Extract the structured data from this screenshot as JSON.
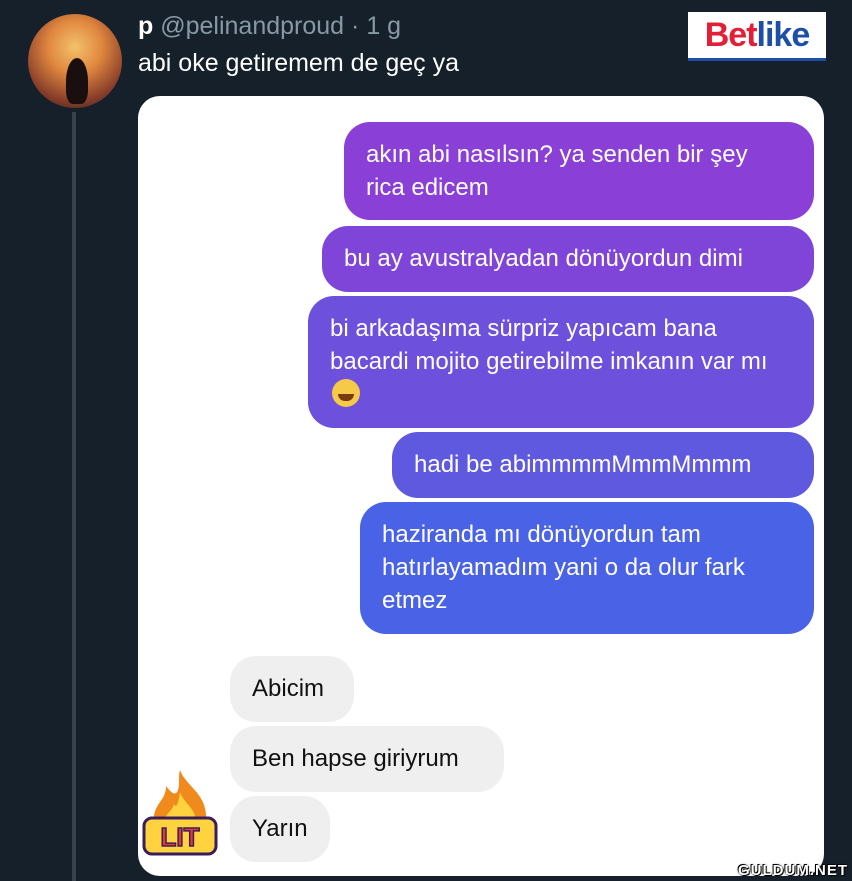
{
  "tweet": {
    "display_name": "p",
    "handle": "@pelinandproud",
    "time": "· 1 g",
    "text": "abi oke getiremem de geç ya"
  },
  "brand": {
    "part1": "Bet",
    "part2": "like"
  },
  "messages": {
    "sent": [
      "akın abi nasılsın? ya senden bir şey rica edicem",
      "bu ay avustralyadan dönüyordun dimi",
      "bi arkadaşıma sürpriz yapıcam bana bacardi mojito getirebilme imkanın var mı",
      "hadi be abimmmmMmmMmmm",
      "haziranda mı dönüyordun tam hatırlayamadım yani o da olur fark etmez"
    ],
    "received": [
      "Abicim",
      "Ben hapse giriyrum",
      "Yarın"
    ]
  },
  "sticker": {
    "text": "LIT",
    "icon": "fire-icon"
  },
  "watermark": "GULDUM.NET",
  "colors": {
    "bg": "#15202b",
    "bubble_top": "#8a3fd6",
    "bubble_bottom": "#4a63e6",
    "received": "#efefef"
  }
}
